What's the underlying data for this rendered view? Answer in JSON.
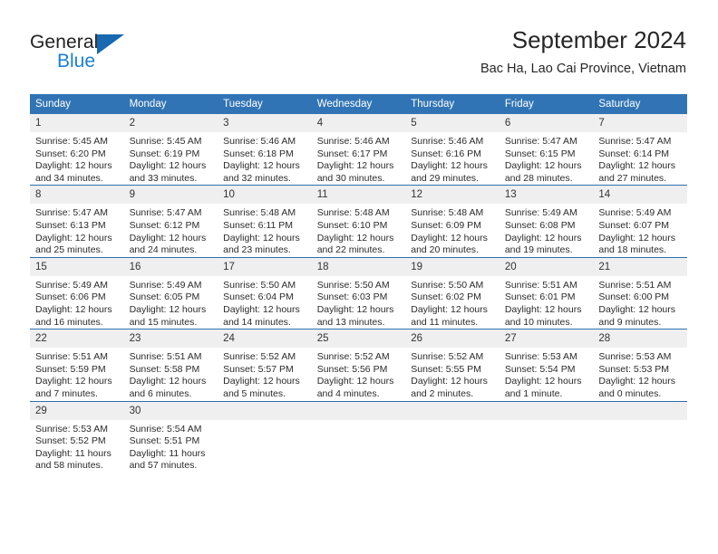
{
  "logo": {
    "word_top": "General",
    "word_bottom": "Blue",
    "accent_color": "#1769b0",
    "blue_text_color": "#1b7fd4"
  },
  "header": {
    "title": "September 2024",
    "subtitle": "Bac Ha, Lao Cai Province, Vietnam"
  },
  "theme": {
    "header_bg": "#3174b5",
    "row_divider": "#2f6fae",
    "daynum_bg": "#efefef"
  },
  "calendar": {
    "weekday_headers": [
      "Sunday",
      "Monday",
      "Tuesday",
      "Wednesday",
      "Thursday",
      "Friday",
      "Saturday"
    ],
    "weeks": [
      {
        "days": [
          {
            "num": "1",
            "sunrise": "Sunrise: 5:45 AM",
            "sunset": "Sunset: 6:20 PM",
            "daylight": "Daylight: 12 hours and 34 minutes."
          },
          {
            "num": "2",
            "sunrise": "Sunrise: 5:45 AM",
            "sunset": "Sunset: 6:19 PM",
            "daylight": "Daylight: 12 hours and 33 minutes."
          },
          {
            "num": "3",
            "sunrise": "Sunrise: 5:46 AM",
            "sunset": "Sunset: 6:18 PM",
            "daylight": "Daylight: 12 hours and 32 minutes."
          },
          {
            "num": "4",
            "sunrise": "Sunrise: 5:46 AM",
            "sunset": "Sunset: 6:17 PM",
            "daylight": "Daylight: 12 hours and 30 minutes."
          },
          {
            "num": "5",
            "sunrise": "Sunrise: 5:46 AM",
            "sunset": "Sunset: 6:16 PM",
            "daylight": "Daylight: 12 hours and 29 minutes."
          },
          {
            "num": "6",
            "sunrise": "Sunrise: 5:47 AM",
            "sunset": "Sunset: 6:15 PM",
            "daylight": "Daylight: 12 hours and 28 minutes."
          },
          {
            "num": "7",
            "sunrise": "Sunrise: 5:47 AM",
            "sunset": "Sunset: 6:14 PM",
            "daylight": "Daylight: 12 hours and 27 minutes."
          }
        ]
      },
      {
        "days": [
          {
            "num": "8",
            "sunrise": "Sunrise: 5:47 AM",
            "sunset": "Sunset: 6:13 PM",
            "daylight": "Daylight: 12 hours and 25 minutes."
          },
          {
            "num": "9",
            "sunrise": "Sunrise: 5:47 AM",
            "sunset": "Sunset: 6:12 PM",
            "daylight": "Daylight: 12 hours and 24 minutes."
          },
          {
            "num": "10",
            "sunrise": "Sunrise: 5:48 AM",
            "sunset": "Sunset: 6:11 PM",
            "daylight": "Daylight: 12 hours and 23 minutes."
          },
          {
            "num": "11",
            "sunrise": "Sunrise: 5:48 AM",
            "sunset": "Sunset: 6:10 PM",
            "daylight": "Daylight: 12 hours and 22 minutes."
          },
          {
            "num": "12",
            "sunrise": "Sunrise: 5:48 AM",
            "sunset": "Sunset: 6:09 PM",
            "daylight": "Daylight: 12 hours and 20 minutes."
          },
          {
            "num": "13",
            "sunrise": "Sunrise: 5:49 AM",
            "sunset": "Sunset: 6:08 PM",
            "daylight": "Daylight: 12 hours and 19 minutes."
          },
          {
            "num": "14",
            "sunrise": "Sunrise: 5:49 AM",
            "sunset": "Sunset: 6:07 PM",
            "daylight": "Daylight: 12 hours and 18 minutes."
          }
        ]
      },
      {
        "days": [
          {
            "num": "15",
            "sunrise": "Sunrise: 5:49 AM",
            "sunset": "Sunset: 6:06 PM",
            "daylight": "Daylight: 12 hours and 16 minutes."
          },
          {
            "num": "16",
            "sunrise": "Sunrise: 5:49 AM",
            "sunset": "Sunset: 6:05 PM",
            "daylight": "Daylight: 12 hours and 15 minutes."
          },
          {
            "num": "17",
            "sunrise": "Sunrise: 5:50 AM",
            "sunset": "Sunset: 6:04 PM",
            "daylight": "Daylight: 12 hours and 14 minutes."
          },
          {
            "num": "18",
            "sunrise": "Sunrise: 5:50 AM",
            "sunset": "Sunset: 6:03 PM",
            "daylight": "Daylight: 12 hours and 13 minutes."
          },
          {
            "num": "19",
            "sunrise": "Sunrise: 5:50 AM",
            "sunset": "Sunset: 6:02 PM",
            "daylight": "Daylight: 12 hours and 11 minutes."
          },
          {
            "num": "20",
            "sunrise": "Sunrise: 5:51 AM",
            "sunset": "Sunset: 6:01 PM",
            "daylight": "Daylight: 12 hours and 10 minutes."
          },
          {
            "num": "21",
            "sunrise": "Sunrise: 5:51 AM",
            "sunset": "Sunset: 6:00 PM",
            "daylight": "Daylight: 12 hours and 9 minutes."
          }
        ]
      },
      {
        "days": [
          {
            "num": "22",
            "sunrise": "Sunrise: 5:51 AM",
            "sunset": "Sunset: 5:59 PM",
            "daylight": "Daylight: 12 hours and 7 minutes."
          },
          {
            "num": "23",
            "sunrise": "Sunrise: 5:51 AM",
            "sunset": "Sunset: 5:58 PM",
            "daylight": "Daylight: 12 hours and 6 minutes."
          },
          {
            "num": "24",
            "sunrise": "Sunrise: 5:52 AM",
            "sunset": "Sunset: 5:57 PM",
            "daylight": "Daylight: 12 hours and 5 minutes."
          },
          {
            "num": "25",
            "sunrise": "Sunrise: 5:52 AM",
            "sunset": "Sunset: 5:56 PM",
            "daylight": "Daylight: 12 hours and 4 minutes."
          },
          {
            "num": "26",
            "sunrise": "Sunrise: 5:52 AM",
            "sunset": "Sunset: 5:55 PM",
            "daylight": "Daylight: 12 hours and 2 minutes."
          },
          {
            "num": "27",
            "sunrise": "Sunrise: 5:53 AM",
            "sunset": "Sunset: 5:54 PM",
            "daylight": "Daylight: 12 hours and 1 minute."
          },
          {
            "num": "28",
            "sunrise": "Sunrise: 5:53 AM",
            "sunset": "Sunset: 5:53 PM",
            "daylight": "Daylight: 12 hours and 0 minutes."
          }
        ]
      },
      {
        "days": [
          {
            "num": "29",
            "sunrise": "Sunrise: 5:53 AM",
            "sunset": "Sunset: 5:52 PM",
            "daylight": "Daylight: 11 hours and 58 minutes."
          },
          {
            "num": "30",
            "sunrise": "Sunrise: 5:54 AM",
            "sunset": "Sunset: 5:51 PM",
            "daylight": "Daylight: 11 hours and 57 minutes."
          },
          {
            "num": "",
            "sunrise": "",
            "sunset": "",
            "daylight": ""
          },
          {
            "num": "",
            "sunrise": "",
            "sunset": "",
            "daylight": ""
          },
          {
            "num": "",
            "sunrise": "",
            "sunset": "",
            "daylight": ""
          },
          {
            "num": "",
            "sunrise": "",
            "sunset": "",
            "daylight": ""
          },
          {
            "num": "",
            "sunrise": "",
            "sunset": "",
            "daylight": ""
          }
        ]
      }
    ]
  }
}
